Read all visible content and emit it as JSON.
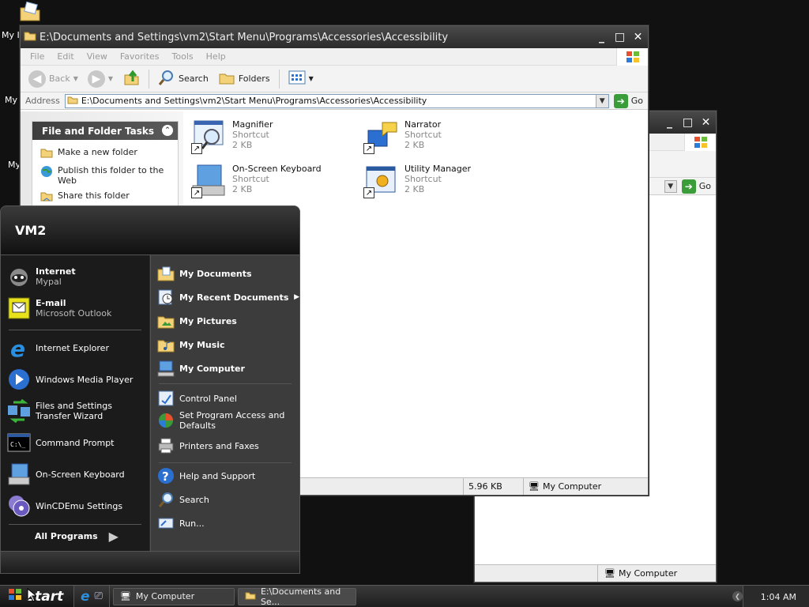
{
  "desktop": {
    "icon_labels": [
      "My I",
      "My",
      "My"
    ]
  },
  "explorer": {
    "title": "E:\\Documents and Settings\\vm2\\Start Menu\\Programs\\Accessories\\Accessibility",
    "menu": [
      "File",
      "Edit",
      "View",
      "Favorites",
      "Tools",
      "Help"
    ],
    "toolbar": {
      "back": "Back",
      "search": "Search",
      "folders": "Folders"
    },
    "address_label": "Address",
    "address_value": "E:\\Documents and Settings\\vm2\\Start Menu\\Programs\\Accessories\\Accessibility",
    "go": "Go",
    "task_pane": {
      "title": "File and Folder Tasks",
      "links": [
        "Make a new folder",
        "Publish this folder to the Web",
        "Share this folder"
      ]
    },
    "files": [
      {
        "name": "Magnifier",
        "type": "Shortcut",
        "size": "2 KB"
      },
      {
        "name": "Narrator",
        "type": "Shortcut",
        "size": "2 KB"
      },
      {
        "name": "On-Screen Keyboard",
        "type": "Shortcut",
        "size": "2 KB"
      },
      {
        "name": "Utility Manager",
        "type": "Shortcut",
        "size": "2 KB"
      }
    ],
    "status": {
      "size": "5.96 KB",
      "location": "My Computer"
    }
  },
  "back_window": {
    "go": "Go",
    "status_location": "My Computer"
  },
  "start_menu": {
    "user": "VM2",
    "pinned": [
      {
        "title": "Internet",
        "sub": "Mypal"
      },
      {
        "title": "E-mail",
        "sub": "Microsoft Outlook"
      }
    ],
    "recent": [
      "Internet Explorer",
      "Windows Media Player",
      "Files and Settings Transfer Wizard",
      "Command Prompt",
      "On-Screen Keyboard",
      "WinCDEmu Settings"
    ],
    "all_programs": "All Programs",
    "right_top": [
      "My Documents",
      "My Recent Documents",
      "My Pictures",
      "My Music",
      "My Computer"
    ],
    "right_mid": [
      "Control Panel",
      "Set Program Access and Defaults",
      "Printers and Faxes"
    ],
    "right_bottom": [
      "Help and Support",
      "Search",
      "Run..."
    ]
  },
  "taskbar": {
    "start": "start",
    "tasks": [
      "My Computer",
      "E:\\Documents and Se..."
    ],
    "clock": "1:04 AM"
  }
}
